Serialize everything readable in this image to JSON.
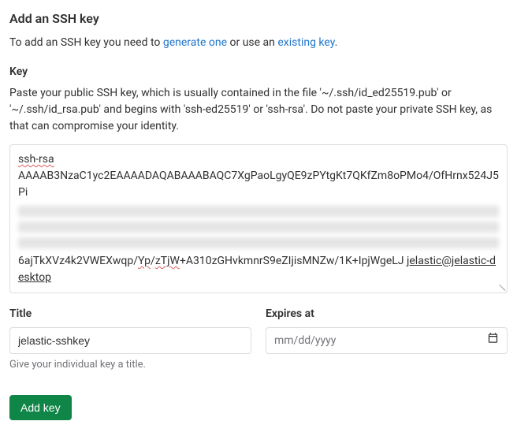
{
  "heading": "Add an SSH key",
  "intro": {
    "prefix": "To add an SSH key you need to ",
    "link_generate": "generate one",
    "mid": " or use an ",
    "link_existing": "existing key",
    "suffix": "."
  },
  "key": {
    "label": "Key",
    "help": "Paste your public SSH key, which is usually contained in the file '~/.ssh/id_ed25519.pub' or '~/.ssh/id_rsa.pub' and begins with 'ssh-ed25519' or 'ssh-rsa'. Do not paste your private SSH key, as that can compromise your identity.",
    "line1_prefix": "ssh-rsa",
    "line2": "AAAAB3NzaC1yc2EAAAADAQABAAABAQC7XgPaoLgyQE9zPYtgKt7QKfZm8oPMo4/OfHrnx524J5Pi",
    "line5_a": "6ajTkXVz4k2VWEXwqp/",
    "line5_b": "Yp",
    "line5_c": "/",
    "line5_d": "zTjW",
    "line5_e": "+A310zGHvkmnrS9eZIjisMNZw/1K+IpjWgeLJ ",
    "line5_f": "jelastic@jelastic-desktop"
  },
  "title": {
    "label": "Title",
    "value": "jelastic-sshkey",
    "hint": "Give your individual key a title."
  },
  "expires": {
    "label": "Expires at",
    "placeholder": "mm/dd/yyyy"
  },
  "button": "Add key",
  "icons": {
    "calendar": "calendar-icon"
  }
}
